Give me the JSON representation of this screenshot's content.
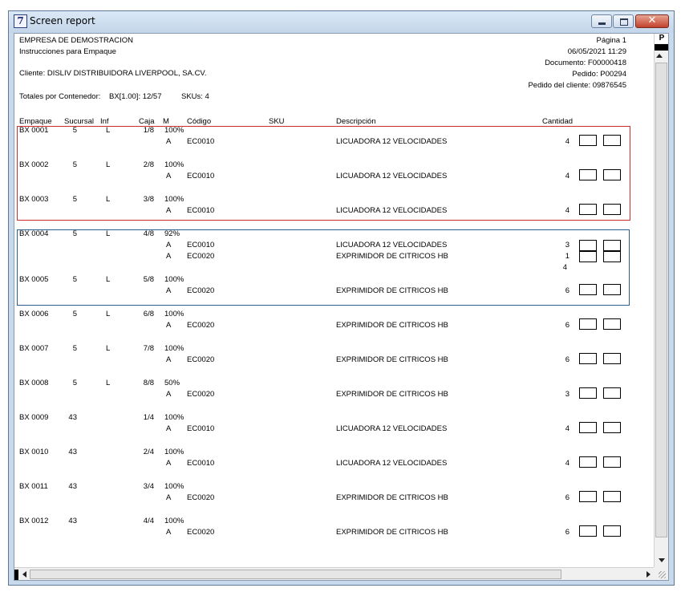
{
  "window": {
    "title": "Screen report",
    "app_icon": "7",
    "close_glyph": "✕"
  },
  "header": {
    "company": "EMPRESA DE DEMOSTRACION",
    "subtitle": "Instrucciones para Empaque",
    "client": "Cliente: DISLIV  DISTRIBUIDORA LIVERPOOL, SA.CV.",
    "totals_label": "Totales por Contenedor:",
    "totals_value": "BX[1.00]: 12/57",
    "skus": "SKUs: 4",
    "page": "Página 1",
    "datetime": "06/05/2021  11:29",
    "document": "Documento: F00000418",
    "order": "Pedido: P00294",
    "client_order": "Pedido del cliente: 09876545"
  },
  "columns": {
    "empaque": "Empaque",
    "sucursal": "Sucursal",
    "inf": "Inf",
    "caja": "Caja",
    "m": "M",
    "codigo": "Código",
    "sku": "SKU",
    "descripcion": "Descripción",
    "cantidad": "Cantidad"
  },
  "scrollbar": {
    "top_label": "P"
  },
  "colors": {
    "red_group": "#cc2e2e",
    "blue_group": "#2b5d8c"
  },
  "rows": [
    {
      "empaque": "BX 0001",
      "sucursal": "5",
      "inf": "L",
      "caja": "1/8",
      "pct": "100%",
      "items": [
        {
          "m": "A",
          "codigo": "EC0010",
          "descripcion": "LICUADORA 12 VELOCIDADES",
          "cantidad": "4"
        }
      ]
    },
    {
      "empaque": "BX 0002",
      "sucursal": "5",
      "inf": "L",
      "caja": "2/8",
      "pct": "100%",
      "items": [
        {
          "m": "A",
          "codigo": "EC0010",
          "descripcion": "LICUADORA 12 VELOCIDADES",
          "cantidad": "4"
        }
      ]
    },
    {
      "empaque": "BX 0003",
      "sucursal": "5",
      "inf": "L",
      "caja": "3/8",
      "pct": "100%",
      "items": [
        {
          "m": "A",
          "codigo": "EC0010",
          "descripcion": "LICUADORA 12 VELOCIDADES",
          "cantidad": "4"
        }
      ]
    },
    {
      "empaque": "BX 0004",
      "sucursal": "5",
      "inf": "L",
      "caja": "4/8",
      "pct": "92%",
      "items": [
        {
          "m": "A",
          "codigo": "EC0010",
          "descripcion": "LICUADORA 12 VELOCIDADES",
          "cantidad": "3"
        },
        {
          "m": "A",
          "codigo": "EC0020",
          "descripcion": "EXPRIMIDOR DE CITRICOS HB",
          "cantidad": "1"
        }
      ],
      "subtotal": "4"
    },
    {
      "empaque": "BX 0005",
      "sucursal": "5",
      "inf": "L",
      "caja": "5/8",
      "pct": "100%",
      "items": [
        {
          "m": "A",
          "codigo": "EC0020",
          "descripcion": "EXPRIMIDOR DE CITRICOS HB",
          "cantidad": "6"
        }
      ]
    },
    {
      "empaque": "BX 0006",
      "sucursal": "5",
      "inf": "L",
      "caja": "6/8",
      "pct": "100%",
      "items": [
        {
          "m": "A",
          "codigo": "EC0020",
          "descripcion": "EXPRIMIDOR DE CITRICOS HB",
          "cantidad": "6"
        }
      ]
    },
    {
      "empaque": "BX 0007",
      "sucursal": "5",
      "inf": "L",
      "caja": "7/8",
      "pct": "100%",
      "items": [
        {
          "m": "A",
          "codigo": "EC0020",
          "descripcion": "EXPRIMIDOR DE CITRICOS HB",
          "cantidad": "6"
        }
      ]
    },
    {
      "empaque": "BX 0008",
      "sucursal": "5",
      "inf": "L",
      "caja": "8/8",
      "pct": "50%",
      "items": [
        {
          "m": "A",
          "codigo": "EC0020",
          "descripcion": "EXPRIMIDOR DE CITRICOS HB",
          "cantidad": "3"
        }
      ]
    },
    {
      "empaque": "BX 0009",
      "sucursal": "43",
      "inf": "",
      "caja": "1/4",
      "pct": "100%",
      "items": [
        {
          "m": "A",
          "codigo": "EC0010",
          "descripcion": "LICUADORA 12 VELOCIDADES",
          "cantidad": "4"
        }
      ]
    },
    {
      "empaque": "BX 0010",
      "sucursal": "43",
      "inf": "",
      "caja": "2/4",
      "pct": "100%",
      "items": [
        {
          "m": "A",
          "codigo": "EC0010",
          "descripcion": "LICUADORA 12 VELOCIDADES",
          "cantidad": "4"
        }
      ]
    },
    {
      "empaque": "BX 0011",
      "sucursal": "43",
      "inf": "",
      "caja": "3/4",
      "pct": "100%",
      "items": [
        {
          "m": "A",
          "codigo": "EC0020",
          "descripcion": "EXPRIMIDOR DE CITRICOS HB",
          "cantidad": "6"
        }
      ]
    },
    {
      "empaque": "BX 0012",
      "sucursal": "43",
      "inf": "",
      "caja": "4/4",
      "pct": "100%",
      "items": [
        {
          "m": "A",
          "codigo": "EC0020",
          "descripcion": "EXPRIMIDOR DE CITRICOS HB",
          "cantidad": "6"
        }
      ]
    }
  ]
}
